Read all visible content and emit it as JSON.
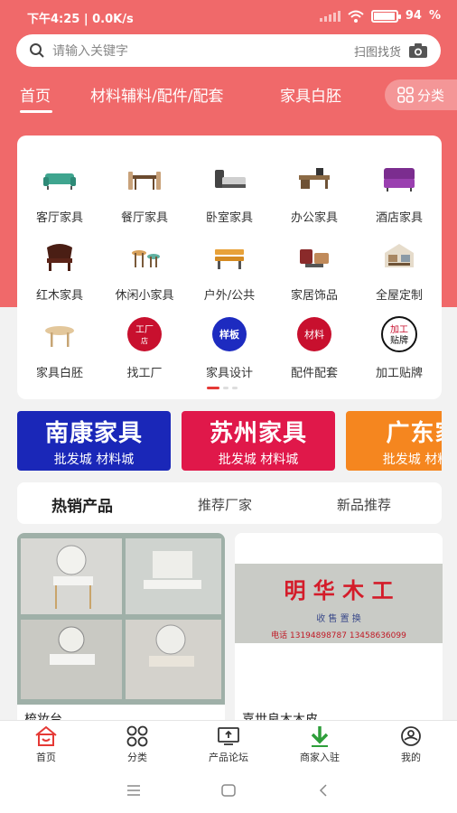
{
  "status_bar": {
    "time": "下午4:25 | 0.0K/s",
    "battery": "94",
    "battery_level": 0.94
  },
  "search": {
    "placeholder": "请输入关键字",
    "scan_label": "扫图找货",
    "icon": "search-icon",
    "camera_icon": "camera-icon"
  },
  "tabs": [
    {
      "label": "首页",
      "active": true
    },
    {
      "label": "材料辅料/配件/配套"
    },
    {
      "label": "家具白胚"
    }
  ],
  "category_button": {
    "label": "分类",
    "icon": "grid-icon"
  },
  "grid": [
    {
      "label": "客厅家具",
      "icon": "sofa-icon"
    },
    {
      "label": "餐厅家具",
      "icon": "dining-table-icon"
    },
    {
      "label": "卧室家具",
      "icon": "bed-icon"
    },
    {
      "label": "办公家具",
      "icon": "office-desk-icon"
    },
    {
      "label": "酒店家具",
      "icon": "hotel-sofa-icon"
    },
    {
      "label": "红木家具",
      "icon": "rosewood-chair-icon"
    },
    {
      "label": "休闲小家具",
      "icon": "stool-icon"
    },
    {
      "label": "户外/公共",
      "icon": "bench-icon"
    },
    {
      "label": "家居饰品",
      "icon": "decor-icon"
    },
    {
      "label": "全屋定制",
      "icon": "house-layout-icon"
    },
    {
      "label": "家具白胚",
      "icon": "round-table-icon"
    },
    {
      "label": "找工厂",
      "icon": "factory-badge-icon",
      "badge": "工厂店",
      "badge_top": "工厂",
      "badge_bottom": "店"
    },
    {
      "label": "家具设计",
      "icon": "sample-badge-icon",
      "badge": "样板"
    },
    {
      "label": "配件配套",
      "icon": "material-badge-icon",
      "badge": "材料"
    },
    {
      "label": "加工贴牌",
      "icon": "oem-badge-icon",
      "badge": "加工贴牌",
      "badge_top": "加工",
      "badge_bottom": "贴牌"
    }
  ],
  "banners": [
    {
      "title": "南康家具",
      "subtitle": "批发城 材料城",
      "color": "#1a27b8"
    },
    {
      "title": "苏州家具",
      "subtitle": "批发城 材料城",
      "color": "#e0184a"
    },
    {
      "title": "广东家",
      "subtitle": "批发城 材料城",
      "color": "#f5861f"
    }
  ],
  "hot_tabs": [
    {
      "label": "热销产品",
      "active": true
    },
    {
      "label": "推荐厂家"
    },
    {
      "label": "新品推荐"
    }
  ],
  "products": [
    {
      "title": "梳妆台"
    },
    {
      "title": "嘉世良木木皮",
      "sign_main": "明 华 木 工",
      "sign_sub": "收 售 置 换",
      "sign_phone": "电话 13194898787  13458636099"
    }
  ],
  "bottom_nav": [
    {
      "label": "首页",
      "icon": "home-icon",
      "active": true
    },
    {
      "label": "分类",
      "icon": "grid-icon"
    },
    {
      "label": "产品论坛",
      "icon": "forum-icon"
    },
    {
      "label": "商家入驻",
      "icon": "download-arrow-icon"
    },
    {
      "label": "我的",
      "icon": "profile-icon"
    }
  ],
  "system_nav": {
    "menu_icon": "menu-icon",
    "home_icon": "square-icon",
    "back_icon": "back-icon"
  },
  "colors": {
    "brand": "#f0696a",
    "active_red": "#e53935",
    "nav_green": "#2e9e3a"
  }
}
